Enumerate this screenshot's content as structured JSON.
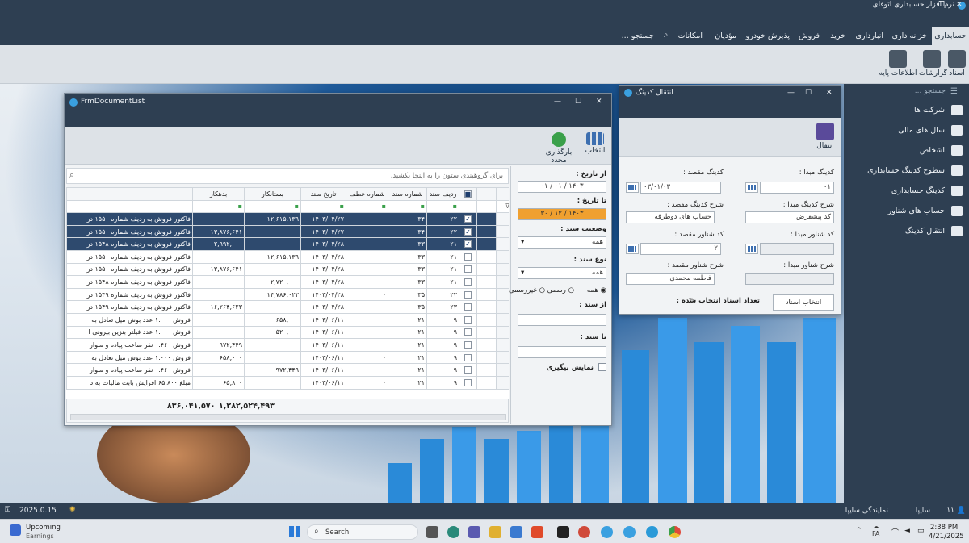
{
  "app": {
    "title": "نرم افزار حسابداری اتوفای"
  },
  "menu": {
    "active": "حسابداری",
    "items": [
      "خزانه داری",
      "انبارداری",
      "خرید",
      "فروش",
      "پذیرش خودرو",
      "مؤدیان",
      "امکانات",
      "جستجو ..."
    ]
  },
  "ribbon": {
    "items": [
      "اسناد",
      "گزارشات",
      "اطلاعات پایه"
    ]
  },
  "nav": {
    "search_placeholder": "جستجو ...",
    "items": [
      "شرکت ها",
      "سال های مالی",
      "اشخاص",
      "سطوح کدینگ حسابداری",
      "کدینگ حسابداری",
      "حساب های شناور",
      "انتقال کدینگ"
    ]
  },
  "doclist": {
    "title": "FrmDocumentList",
    "toolbar": {
      "select": "انتخاب",
      "reload": "بارگذاری مجدد"
    },
    "group_hint": "برای گروهبندی ستون را به اینجا بکشید.",
    "columns": [
      "ردیف سند",
      "شماره سند",
      "شماره عطف",
      "تاریخ سند",
      "بستانکار",
      "بدهکار"
    ],
    "rows": [
      {
        "n": "۱",
        "sel": true,
        "checked": true,
        "row": "۲۲",
        "doc": "۳۴",
        "atf": "۰",
        "date": "۱۴۰۳/۰۴/۲۷",
        "cred": "۱۲,۶۱۵,۱۳۹",
        "deb": "",
        "desc": "فاکتور فروش به ردیف شماره ۱۵۵۰ در"
      },
      {
        "n": "۲",
        "sel": true,
        "checked": true,
        "row": "۲۲",
        "doc": "۳۴",
        "atf": "۰",
        "date": "۱۴۰۳/۰۴/۲۷",
        "cred": "",
        "deb": "۱۳,۸۷۶,۶۴۱",
        "desc": "فاکتور فروش به ردیف شماره ۱۵۵۰ در"
      },
      {
        "n": "۳",
        "sel": true,
        "checked": true,
        "row": "۲۱",
        "doc": "۳۳",
        "atf": "۰",
        "date": "۱۴۰۳/۰۴/۲۸",
        "cred": "",
        "deb": "۲,۹۹۲,۰۰۰",
        "desc": "فاکتور فروش به ردیف شماره ۱۵۴۸ در"
      },
      {
        "n": "۴",
        "sel": false,
        "checked": false,
        "row": "۲۱",
        "doc": "۳۳",
        "atf": "۰",
        "date": "۱۴۰۳/۰۴/۲۸",
        "cred": "۱۲,۶۱۵,۱۳۹",
        "deb": "",
        "desc": "فاکتور فروش به ردیف شماره ۱۵۵۰ در"
      },
      {
        "n": "۵",
        "sel": false,
        "checked": false,
        "row": "۲۱",
        "doc": "۳۳",
        "atf": "۰",
        "date": "۱۴۰۳/۰۴/۲۸",
        "cred": "",
        "deb": "۱۳,۸۷۶,۶۴۱",
        "desc": "فاکتور فروش به ردیف شماره ۱۵۵۰ در"
      },
      {
        "n": "۶",
        "sel": false,
        "checked": false,
        "row": "۲۱",
        "doc": "۳۳",
        "atf": "۰",
        "date": "۱۴۰۳/۰۴/۲۸",
        "cred": "۲,۷۲۰,۰۰۰",
        "deb": "",
        "desc": "فاکتور فروش به ردیف شماره ۱۵۴۸ در"
      },
      {
        "n": "۷",
        "sel": false,
        "checked": false,
        "row": "۲۲",
        "doc": "۳۵",
        "atf": "۰",
        "date": "۱۴۰۳/۰۴/۲۸",
        "cred": "۱۴,۷۸۶,۰۲۲",
        "deb": "",
        "desc": "فاکتور فروش به ردیف شماره ۱۵۴۹ در"
      },
      {
        "n": "۸",
        "sel": false,
        "checked": false,
        "row": "۲۳",
        "doc": "۳۵",
        "atf": "۰",
        "date": "۱۴۰۳/۰۴/۲۸",
        "cred": "",
        "deb": "۱۶,۲۶۴,۶۲۳",
        "desc": "فاکتور فروش به ردیف شماره ۱۵۴۹ در"
      },
      {
        "n": "۹",
        "sel": false,
        "checked": false,
        "row": "۹",
        "doc": "۲۱",
        "atf": "۰",
        "date": "۱۴۰۳/۰۶/۱۱",
        "cred": "۶۵۸,۰۰۰",
        "deb": "",
        "desc": "فروش ۱.۰۰۰ عدد بوش میل تعادل به"
      },
      {
        "n": "۱۰",
        "sel": false,
        "checked": false,
        "row": "۹",
        "doc": "۲۱",
        "atf": "۰",
        "date": "۱۴۰۳/۰۶/۱۱",
        "cred": "۵۲۰,۰۰۰",
        "deb": "",
        "desc": "فروش ۱.۰۰۰ عدد فیلتر بنزین بیرونی ا"
      },
      {
        "n": "۱۱",
        "sel": false,
        "checked": false,
        "row": "۹",
        "doc": "۲۱",
        "atf": "۰",
        "date": "۱۴۰۳/۰۶/۱۱",
        "cred": "",
        "deb": "۹۷۲,۴۴۹",
        "desc": "فروش ۰.۴۶۰ نفر ساعت پیاده و سوار"
      },
      {
        "n": "۱۲",
        "sel": false,
        "checked": false,
        "row": "۹",
        "doc": "۲۱",
        "atf": "۰",
        "date": "۱۴۰۳/۰۶/۱۱",
        "cred": "",
        "deb": "۶۵۸,۰۰۰",
        "desc": "فروش ۱.۰۰۰ عدد بوش میل تعادل به"
      },
      {
        "n": "۱۳",
        "sel": false,
        "checked": false,
        "row": "۹",
        "doc": "۲۱",
        "atf": "۰",
        "date": "۱۴۰۳/۰۶/۱۱",
        "cred": "۹۷۲,۴۴۹",
        "deb": "",
        "desc": "فروش ۰.۴۶۰ نفر ساعت پیاده و سوار"
      },
      {
        "n": "۱۴",
        "sel": false,
        "checked": false,
        "row": "۹",
        "doc": "۲۱",
        "atf": "۰",
        "date": "۱۴۰۳/۰۶/۱۱",
        "cred": "",
        "deb": "۶۵,۸۰۰",
        "desc": "مبلغ ۶۵,۸۰۰ افزایش بابت مالیات به د"
      }
    ],
    "totals": {
      "cred": "۱,۲۸۲,۵۲۴,۴۹۳",
      "deb": "۸۳۶,۰۴۱,۵۷۰"
    },
    "filters": {
      "from_date": "از تاریخ :",
      "from_value": "۱۴۰۳ / ۰۱ / ۰۱",
      "to_date": "تا تاریخ :",
      "to_value": "۱۴۰۳ / ۱۲ / ۳۰",
      "status": "وضعیت سند :",
      "status_value": "همه",
      "type": "نوع سند :",
      "type_value": "همه",
      "radios": [
        "همه",
        "رسمی",
        "غیررسمی"
      ],
      "from_doc": "از سند :",
      "to_doc": "تا سند :",
      "measure": "نمایش بیگیری"
    }
  },
  "transfer": {
    "title": "انتقال کدینگ",
    "action": "انتقال",
    "src_code": "کدینگ مبدا :",
    "src_code_value": "۰۱",
    "dst_code": "کدینگ مقصد :",
    "dst_code_value": "۰۳/۰۱/۰۳",
    "src_desc": "شرح کدینگ مبدا :",
    "src_desc_value": "کد پیشفرض",
    "dst_desc": "شرح کدینگ مقصد :",
    "dst_desc_value": "حساب های دوطرفه",
    "src_float": "کد شناور مبدا :",
    "dst_float": "کد شناور مقصد :",
    "dst_float_value": "۲",
    "src_float_desc": "شرح شناور مبدا :",
    "dst_float_desc": "شرح شناور مقصد :",
    "dst_float_desc_value": "فاطمه محمدی",
    "select_btn": "انتخاب اسناد",
    "count_label": "تعداد اسناد انتخاب شده :",
    "count": "۳"
  },
  "status": {
    "user": "۱۱",
    "company": "سایپا",
    "branch": "نمایندگی سایپا",
    "version": "2025.0.15"
  },
  "taskbar": {
    "weather_title": "Upcoming",
    "weather_sub": "Earnings",
    "search": "Search",
    "time": "2:38 PM",
    "date": "4/21/2025",
    "lang": "FA"
  }
}
